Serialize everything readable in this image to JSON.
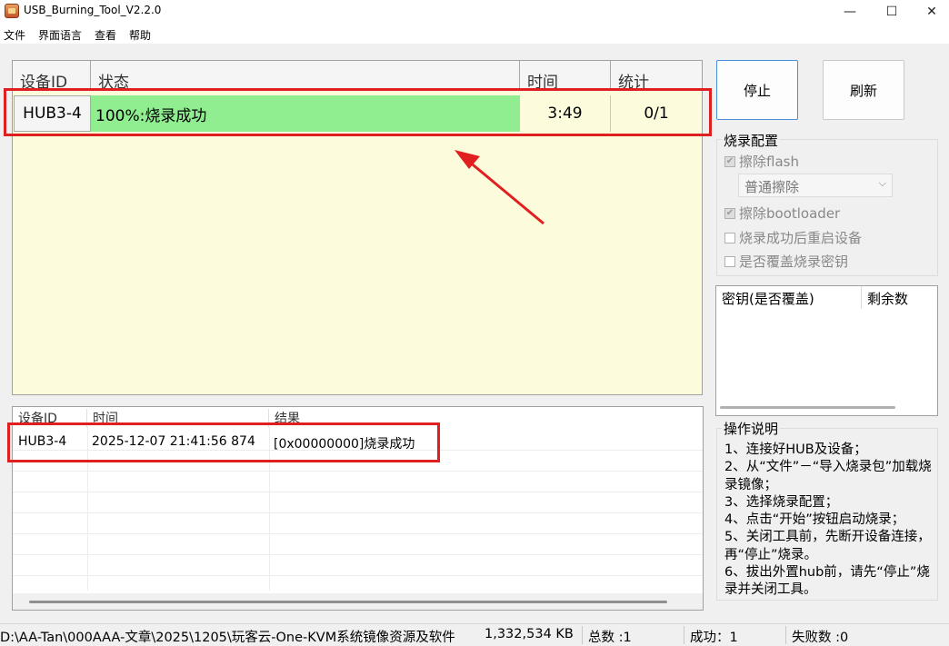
{
  "window": {
    "title": "USB_Burning_Tool_V2.2.0"
  },
  "menu": [
    "文件",
    "界面语言",
    "查看",
    "帮助"
  ],
  "device_table": {
    "headers": {
      "device_id": "设备ID",
      "status": "状态",
      "time": "时间",
      "stats": "统计"
    },
    "row": {
      "device_id": "HUB3-4",
      "status": "100%:烧录成功",
      "time": "3:49",
      "stats": "0/1"
    },
    "progress": 1.0,
    "colors": {
      "success": "#90ee90",
      "background": "#fcfcdc",
      "annotation": "#e02020"
    }
  },
  "buttons": {
    "stop": "停止",
    "refresh": "刷新"
  },
  "burn_config": {
    "title": "烧录配置",
    "erase_flash": {
      "label": "擦除flash",
      "checked": true,
      "enabled": false
    },
    "erase_mode": "普通擦除",
    "erase_bootloader": {
      "label": "擦除bootloader",
      "checked": true,
      "enabled": false
    },
    "reboot_after_success": {
      "label": "烧录成功后重启设备",
      "checked": false,
      "enabled": false
    },
    "overwrite_key": {
      "label": "是否覆盖烧录密钥",
      "checked": false,
      "enabled": false
    }
  },
  "key_table": {
    "headers": {
      "key": "密钥(是否覆盖)",
      "remaining": "剩余数"
    }
  },
  "log_table": {
    "headers": {
      "device_id": "设备ID",
      "time": "时间",
      "result": "结果"
    },
    "rows": [
      {
        "device_id": "HUB3-4",
        "time": "2025-12-07 21:41:56 874",
        "result": "[0x00000000]烧录成功"
      }
    ]
  },
  "instructions": {
    "title": "操作说明",
    "lines": [
      "1、连接好HUB及设备；",
      "2、从“文件”－“导入烧录包”加载烧录镜像；",
      "3、选择烧录配置；",
      "4、点击“开始”按钮启动烧录；",
      "5、关闭工具前，先断开设备连接，再“停止”烧录。",
      "6、拔出外置hub前，请先“停止”烧录并关闭工具。"
    ]
  },
  "status_bar": {
    "path": "D:\\AA-Tan\\000AAA-文章\\2025\\1205\\玩客云-One-KVM系统镜像资源及软件",
    "size": "1,332,534 KB",
    "total": "总数 :1",
    "success": "成功：1",
    "fail": "失败数 :0"
  }
}
